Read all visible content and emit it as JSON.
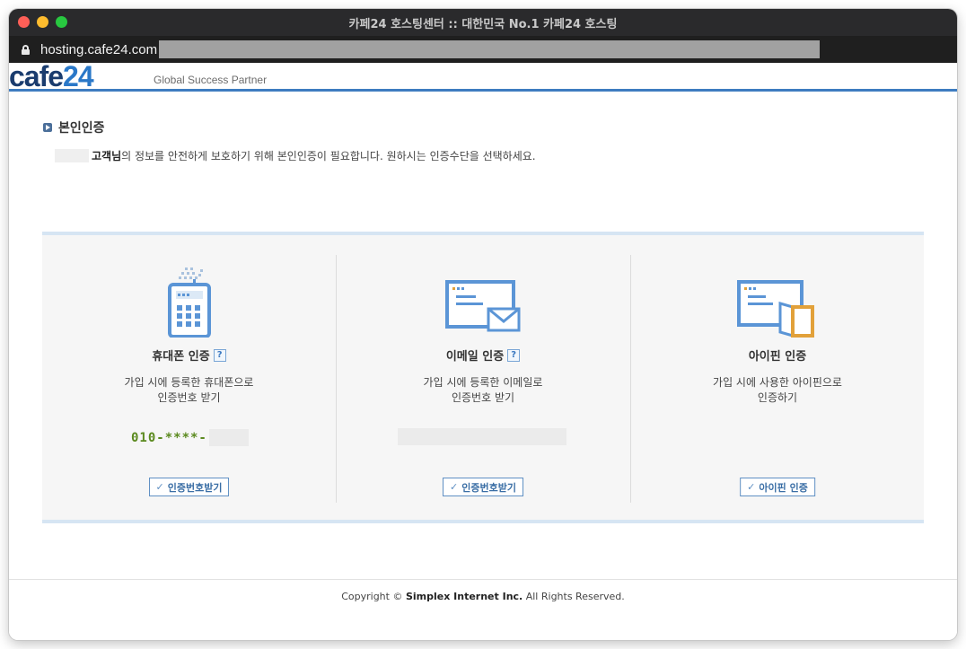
{
  "window": {
    "title": "카페24 호스팅센터 :: 대한민국 No.1 카페24 호스팅",
    "url": "hosting.cafe24.com"
  },
  "header": {
    "logo_part1": "cafe",
    "logo_part2": "24",
    "tagline": "Global Success Partner"
  },
  "section": {
    "title": "본인인증",
    "customer_suffix": "고객님",
    "notice": "의 정보를 안전하게 보호하기 위해 본인인증이 필요합니다. 원하시는 인증수단을 선택하세요."
  },
  "methods": [
    {
      "title": "휴대폰 인증",
      "help": "?",
      "desc_line1": "가입 시에 등록한 휴대폰으로",
      "desc_line2": "인증번호 받기",
      "value": "010-****-",
      "button": "인증번호받기",
      "icon": "mobile-phone-icon"
    },
    {
      "title": "이메일 인증",
      "help": "?",
      "desc_line1": "가입 시에 등록한 이메일로",
      "desc_line2": "인증번호 받기",
      "button": "인증번호받기",
      "icon": "email-icon"
    },
    {
      "title": "아이핀 인증",
      "desc_line1": "가입 시에 사용한 아이핀으로",
      "desc_line2": "인증하기",
      "button": "아이핀 인증",
      "icon": "ipin-icon"
    }
  ],
  "footer": {
    "copy_prefix": "Copyright © ",
    "company": "Simplex Internet Inc.",
    "copy_suffix": " All Rights Reserved."
  },
  "colors": {
    "accent": "#3e7cc0",
    "phone_number": "#5b8a1f"
  }
}
